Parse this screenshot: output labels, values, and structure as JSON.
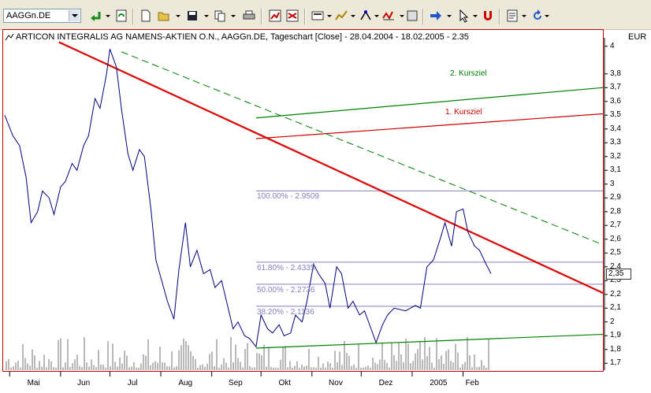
{
  "toolbar": {
    "symbol_value": "AAGGn.DE",
    "buttons": [
      "back-icon",
      "refresh-icon",
      "new-icon",
      "open-icon",
      "save-icon",
      "copy-icon",
      "print-icon",
      "add-indicator-icon",
      "chart-type-icon",
      "drawing-icon",
      "trendline-icon",
      "fibonacci-icon",
      "arrow-tool-icon",
      "cursor-icon",
      "magnet-icon",
      "properties-icon",
      "undo-icon"
    ]
  },
  "chart": {
    "title": "ARTICON INTEGRALIS AG NAMENS-AKTIEN O.N., AAGGn.DE, Tageschart [Close] - 28.04.2004 - 18.02.2005 - 2.35",
    "currency": "EUR",
    "last_price": "2,35",
    "y_ticks": [
      "4",
      "3,8",
      "3,7",
      "3,6",
      "3,5",
      "3,4",
      "3,3",
      "3,2",
      "3,1",
      "3",
      "2,9",
      "2,8",
      "2,7",
      "2,6",
      "2,5",
      "2,4",
      "2,3",
      "2,2",
      "2,1",
      "2",
      "1,9",
      "1,8",
      "1,7"
    ],
    "x_ticks": [
      "Mai",
      "Jun",
      "Jul",
      "Aug",
      "Sep",
      "Okt",
      "Nov",
      "Dez",
      "2005",
      "Feb"
    ],
    "annotations": {
      "kursziel2": "2. Kursziel",
      "kursziel1": "1. Kursziel",
      "fib100": "100.00% - 2.9509",
      "fib618": "61.80% - 2.4335",
      "fib50": "50.00% - 2.2736",
      "fib382": "38.20% - 2.1136"
    },
    "colors": {
      "line": "#000080",
      "trend_down": "#dd0000",
      "trend_green": "#008000",
      "fib": "#8080c0",
      "kursziel1": "#cc0000",
      "kursziel2": "#008000"
    }
  },
  "chart_data": {
    "type": "line",
    "ylim": [
      1.65,
      4.05
    ],
    "xlim": [
      "2004-04-28",
      "2005-02-18"
    ],
    "series": [
      {
        "values": [
          [
            "2004-04-28",
            3.5
          ],
          [
            "2004-05-03",
            3.35
          ],
          [
            "2004-05-07",
            3.28
          ],
          [
            "2004-05-11",
            3.05
          ],
          [
            "2004-05-14",
            2.72
          ],
          [
            "2004-05-18",
            2.8
          ],
          [
            "2004-05-21",
            2.95
          ],
          [
            "2004-05-25",
            2.9
          ],
          [
            "2004-05-28",
            2.78
          ],
          [
            "2004-06-01",
            2.98
          ],
          [
            "2004-06-04",
            3.02
          ],
          [
            "2004-06-08",
            3.15
          ],
          [
            "2004-06-11",
            3.1
          ],
          [
            "2004-06-15",
            3.28
          ],
          [
            "2004-06-18",
            3.35
          ],
          [
            "2004-06-22",
            3.62
          ],
          [
            "2004-06-25",
            3.55
          ],
          [
            "2004-06-29",
            3.8
          ],
          [
            "2004-07-01",
            3.98
          ],
          [
            "2004-07-05",
            3.85
          ],
          [
            "2004-07-08",
            3.55
          ],
          [
            "2004-07-12",
            3.22
          ],
          [
            "2004-07-15",
            3.1
          ],
          [
            "2004-07-19",
            3.25
          ],
          [
            "2004-07-22",
            3.2
          ],
          [
            "2004-07-26",
            2.82
          ],
          [
            "2004-07-29",
            2.45
          ],
          [
            "2004-08-02",
            2.28
          ],
          [
            "2004-08-05",
            2.15
          ],
          [
            "2004-08-09",
            2.02
          ],
          [
            "2004-08-12",
            2.38
          ],
          [
            "2004-08-16",
            2.72
          ],
          [
            "2004-08-19",
            2.4
          ],
          [
            "2004-08-23",
            2.52
          ],
          [
            "2004-08-27",
            2.35
          ],
          [
            "2004-08-31",
            2.38
          ],
          [
            "2004-09-03",
            2.25
          ],
          [
            "2004-09-07",
            2.3
          ],
          [
            "2004-09-10",
            2.15
          ],
          [
            "2004-09-14",
            1.95
          ],
          [
            "2004-09-17",
            2.0
          ],
          [
            "2004-09-21",
            1.9
          ],
          [
            "2004-09-24",
            1.88
          ],
          [
            "2004-09-28",
            1.82
          ],
          [
            "2004-10-01",
            2.05
          ],
          [
            "2004-10-05",
            1.95
          ],
          [
            "2004-10-08",
            1.92
          ],
          [
            "2004-10-12",
            1.98
          ],
          [
            "2004-10-15",
            1.9
          ],
          [
            "2004-10-19",
            1.92
          ],
          [
            "2004-10-22",
            2.05
          ],
          [
            "2004-10-26",
            2.0
          ],
          [
            "2004-10-29",
            2.15
          ],
          [
            "2004-11-02",
            2.42
          ],
          [
            "2004-11-05",
            2.35
          ],
          [
            "2004-11-09",
            2.28
          ],
          [
            "2004-11-12",
            2.1
          ],
          [
            "2004-11-16",
            2.4
          ],
          [
            "2004-11-19",
            2.35
          ],
          [
            "2004-11-23",
            2.1
          ],
          [
            "2004-11-26",
            2.15
          ],
          [
            "2004-11-30",
            2.05
          ],
          [
            "2004-12-03",
            2.08
          ],
          [
            "2004-12-07",
            1.95
          ],
          [
            "2004-12-10",
            1.85
          ],
          [
            "2004-12-14",
            1.98
          ],
          [
            "2004-12-17",
            2.05
          ],
          [
            "2004-12-21",
            2.1
          ],
          [
            "2004-12-28",
            2.08
          ],
          [
            "2005-01-03",
            2.12
          ],
          [
            "2005-01-06",
            2.1
          ],
          [
            "2005-01-10",
            2.4
          ],
          [
            "2005-01-14",
            2.45
          ],
          [
            "2005-01-18",
            2.6
          ],
          [
            "2005-01-21",
            2.72
          ],
          [
            "2005-01-25",
            2.55
          ],
          [
            "2005-01-28",
            2.8
          ],
          [
            "2005-02-01",
            2.82
          ],
          [
            "2005-02-04",
            2.65
          ],
          [
            "2005-02-08",
            2.55
          ],
          [
            "2005-02-11",
            2.52
          ],
          [
            "2005-02-15",
            2.42
          ],
          [
            "2005-02-18",
            2.35
          ]
        ]
      }
    ],
    "volume_visible": true
  }
}
